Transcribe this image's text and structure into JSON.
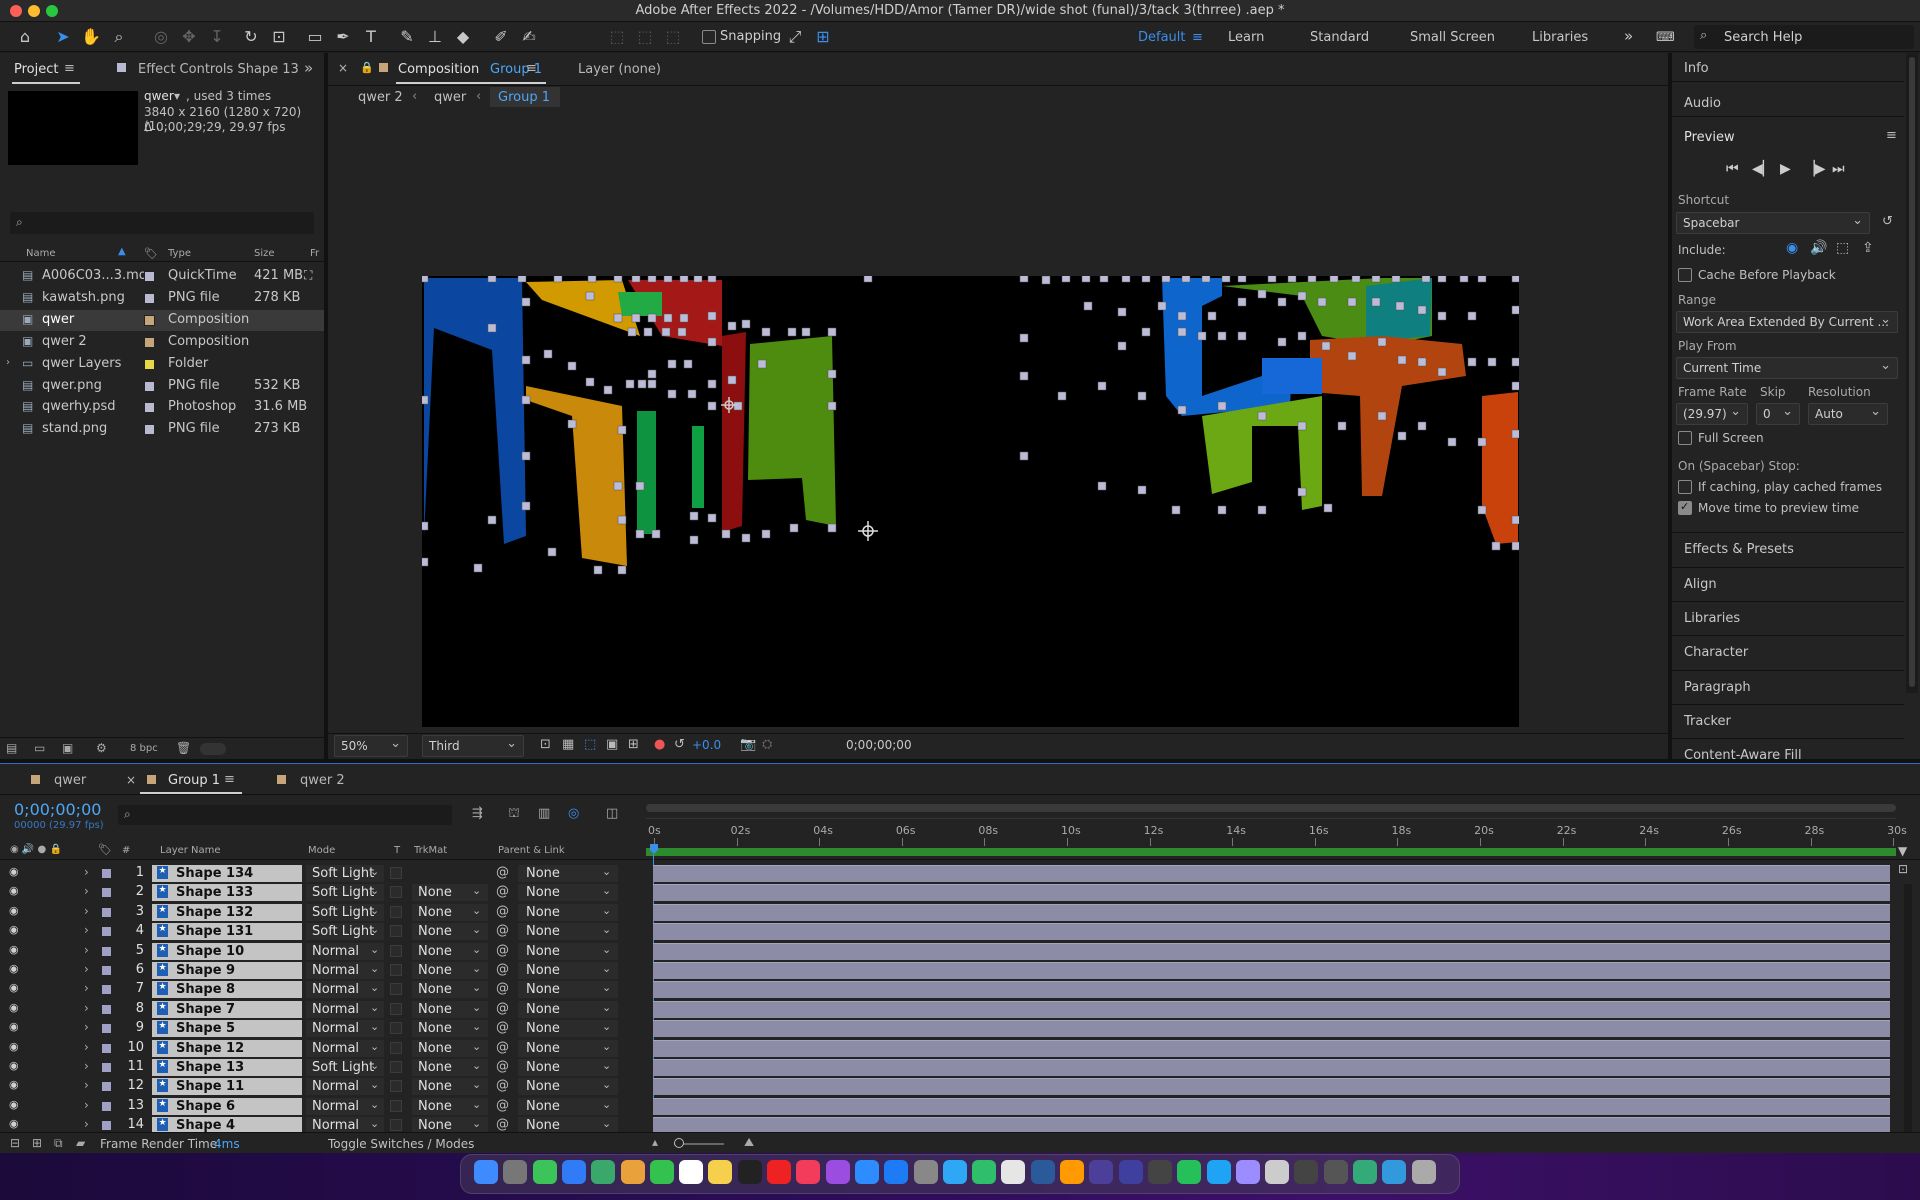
{
  "title": "Adobe After Effects 2022 - /Volumes/HDD/Amor (Tamer DR)/wide shot (funal)/3/tack 3(thrree) .aep *",
  "toolbar": {
    "snapping": "Snapping",
    "workspaces": [
      "Default",
      "Learn",
      "Standard",
      "Small Screen",
      "Libraries"
    ],
    "search": "Search Help"
  },
  "project": {
    "tab": "Project",
    "effects_tab": "Effect Controls Shape 13",
    "item_name": "qwer",
    "item_used": ", used 3 times",
    "item_dims": "3840 x 2160  (1280 x 720) (1...",
    "item_dur": "Δ 0;00;29;29, 29.97 fps",
    "cols": {
      "name": "Name",
      "type": "Type",
      "size": "Size",
      "fr": "Fr"
    },
    "items": [
      {
        "name": "A006C03...3.mov",
        "type": "QuickTime",
        "size": "421 MB",
        "swatch": "#b9b9d2"
      },
      {
        "name": "kawatsh.png",
        "type": "PNG file",
        "size": "278 KB",
        "swatch": "#b9b9d2"
      },
      {
        "name": "qwer",
        "type": "Composition",
        "size": "",
        "swatch": "#c6a57a"
      },
      {
        "name": "qwer 2",
        "type": "Composition",
        "size": "",
        "swatch": "#c6a57a"
      },
      {
        "name": "qwer Layers",
        "type": "Folder",
        "size": "",
        "swatch": "#e5d94a"
      },
      {
        "name": "qwer.png",
        "type": "PNG file",
        "size": "532 KB",
        "swatch": "#b9b9d2"
      },
      {
        "name": "qwerhy.psd",
        "type": "Photoshop",
        "size": "31.6 MB",
        "swatch": "#b9b9d2"
      },
      {
        "name": "stand.png",
        "type": "PNG file",
        "size": "273 KB",
        "swatch": "#b9b9d2"
      }
    ],
    "bpc": "8 bpc"
  },
  "comp": {
    "tab_prefix": "Composition",
    "tab_name": "Group 1",
    "layer_tab": "Layer (none)",
    "crumbs": [
      "qwer 2",
      "qwer",
      "Group 1"
    ],
    "zoom": "50%",
    "res": "Third",
    "exposure": "+0.0",
    "timecode": "0;00;00;00"
  },
  "right": {
    "info": "Info",
    "audio": "Audio",
    "preview": "Preview",
    "shortcut_label": "Shortcut",
    "shortcut": "Spacebar",
    "include": "Include:",
    "cache_before": "Cache Before Playback",
    "range_label": "Range",
    "range": "Work Area Extended By Current ...",
    "play_from_label": "Play From",
    "play_from": "Current Time",
    "frame_rate_label": "Frame Rate",
    "skip_label": "Skip",
    "resolution_label": "Resolution",
    "frame_rate": "(29.97)",
    "skip": "0",
    "resolution": "Auto",
    "full_screen": "Full Screen",
    "on_stop": "On (Spacebar) Stop:",
    "if_caching": "If caching, play cached frames",
    "move_time": "Move time to preview time",
    "panels": [
      "Effects & Presets",
      "Align",
      "Libraries",
      "Character",
      "Paragraph",
      "Tracker",
      "Content-Aware Fill"
    ]
  },
  "timeline": {
    "tabs": [
      "qwer",
      "Group 1",
      "qwer 2"
    ],
    "timecode": "0;00;00;00",
    "fps": "00000 (29.97 fps)",
    "ruler": [
      "0s",
      "02s",
      "04s",
      "06s",
      "08s",
      "10s",
      "12s",
      "14s",
      "16s",
      "18s",
      "20s",
      "22s",
      "24s",
      "26s",
      "28s",
      "30s"
    ],
    "cols": {
      "num": "#",
      "name": "Layer Name",
      "mode": "Mode",
      "t": "T",
      "trkmat": "TrkMat",
      "parent": "Parent & Link"
    },
    "layers": [
      {
        "n": "1",
        "name": "Shape 134",
        "mode": "Soft Light",
        "trk": "",
        "parent": "None"
      },
      {
        "n": "2",
        "name": "Shape 133",
        "mode": "Soft Light",
        "trk": "None",
        "parent": "None"
      },
      {
        "n": "3",
        "name": "Shape 132",
        "mode": "Soft Light",
        "trk": "None",
        "parent": "None"
      },
      {
        "n": "4",
        "name": "Shape 131",
        "mode": "Soft Light",
        "trk": "None",
        "parent": "None"
      },
      {
        "n": "5",
        "name": "Shape 10",
        "mode": "Normal",
        "trk": "None",
        "parent": "None"
      },
      {
        "n": "6",
        "name": "Shape 9",
        "mode": "Normal",
        "trk": "None",
        "parent": "None"
      },
      {
        "n": "7",
        "name": "Shape 8",
        "mode": "Normal",
        "trk": "None",
        "parent": "None"
      },
      {
        "n": "8",
        "name": "Shape 7",
        "mode": "Normal",
        "trk": "None",
        "parent": "None"
      },
      {
        "n": "9",
        "name": "Shape 5",
        "mode": "Normal",
        "trk": "None",
        "parent": "None"
      },
      {
        "n": "10",
        "name": "Shape 12",
        "mode": "Normal",
        "trk": "None",
        "parent": "None"
      },
      {
        "n": "11",
        "name": "Shape 13",
        "mode": "Soft Light",
        "trk": "None",
        "parent": "None"
      },
      {
        "n": "12",
        "name": "Shape 11",
        "mode": "Normal",
        "trk": "None",
        "parent": "None"
      },
      {
        "n": "13",
        "name": "Shape 6",
        "mode": "Normal",
        "trk": "None",
        "parent": "None"
      },
      {
        "n": "14",
        "name": "Shape 4",
        "mode": "Normal",
        "trk": "None",
        "parent": "None"
      }
    ],
    "render_label": "Frame Render Time",
    "render_value": "4ms",
    "toggle": "Toggle Switches / Modes"
  },
  "colors": {
    "accent": "#2d8ceb",
    "timecode": "#4ea6f4",
    "bar": "#8c8ca7",
    "label": "#a0a0c4"
  }
}
